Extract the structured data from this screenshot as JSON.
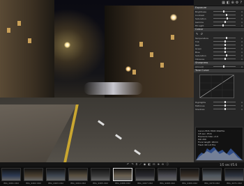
{
  "toolbar_top": {
    "icons": [
      "grid-icon",
      "split-icon",
      "zoom-icon",
      "settings-icon",
      "help-icon"
    ]
  },
  "panel": {
    "exposure": {
      "title": "Exposure",
      "rows": [
        {
          "label": "Brightness",
          "value": "0",
          "level": 0.45
        },
        {
          "label": "Contrast",
          "value": "0",
          "level": 0.55
        },
        {
          "label": "Saturation",
          "value": "0",
          "level": 0.6
        },
        {
          "label": "Gamma",
          "value": "0",
          "level": 0.5
        },
        {
          "label": "Fill Light",
          "value": "0",
          "level": 0.4
        }
      ]
    },
    "colour": {
      "title": "Colour",
      "rows": [
        {
          "label": "Temperature",
          "value": "0",
          "level": 0.55
        },
        {
          "label": "Tint",
          "value": "0",
          "level": 0.5
        },
        {
          "label": "Red",
          "value": "0",
          "level": 0.5
        },
        {
          "label": "Green",
          "value": "0",
          "level": 0.5
        },
        {
          "label": "Blue",
          "value": "0",
          "level": 0.5
        },
        {
          "label": "Saturation",
          "value": "0",
          "level": 0.55
        },
        {
          "label": "Vibrance",
          "value": "0",
          "level": 0.5
        }
      ]
    },
    "sharpness": {
      "title": "Sharpness",
      "rows": [
        {
          "label": "Amount",
          "value": "0",
          "level": 0.45
        }
      ]
    },
    "tone_curve": {
      "title": "Tone Curve",
      "rows": [
        {
          "label": "Highlights",
          "value": "0",
          "level": 0.5
        },
        {
          "label": "Midtones",
          "value": "0",
          "level": 0.5
        },
        {
          "label": "Shadows",
          "value": "0",
          "level": 0.5
        }
      ]
    },
    "histogram_info": [
      "Canon EOS 350D DIGITAL",
      "1/5 sec, f/5.6",
      "Exposure bias +1.0",
      "ISO 200",
      "Focal length 18mm",
      "Flash did not fire"
    ]
  },
  "bottom_bar": {
    "right_label": "1/5 sec f/5.6"
  },
  "filmstrip": [
    {
      "caption": "IMG_4461.CR2",
      "selected": false
    },
    {
      "caption": "IMG_4462.CR2",
      "selected": false
    },
    {
      "caption": "IMG_4463.CR2",
      "selected": false
    },
    {
      "caption": "IMG_4464.CR2",
      "selected": false
    },
    {
      "caption": "IMG_4465.CR2",
      "selected": false
    },
    {
      "caption": "IMG_4466.CR2",
      "selected": true
    },
    {
      "caption": "IMG_4467.CR2",
      "selected": false
    },
    {
      "caption": "IMG_4468.CR2",
      "selected": false
    },
    {
      "caption": "IMG_4469.CR2",
      "selected": false
    },
    {
      "caption": "IMG_4470.CR2",
      "selected": false
    },
    {
      "caption": "IMG_4471.CR2",
      "selected": false
    }
  ]
}
